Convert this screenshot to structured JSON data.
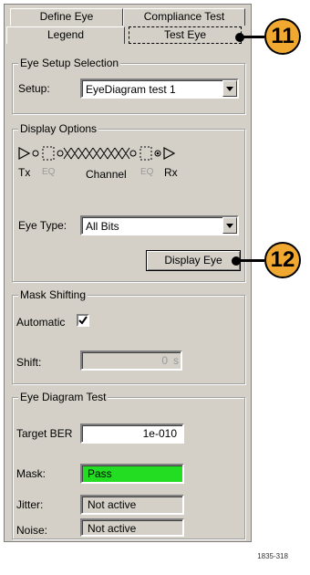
{
  "tabs": {
    "define_eye": "Define Eye",
    "compliance_test": "Compliance Test",
    "legend": "Legend",
    "test_eye": "Test Eye"
  },
  "eye_setup": {
    "title": "Eye Setup Selection",
    "setup_label": "Setup:",
    "setup_value": "EyeDiagram test 1"
  },
  "display_options": {
    "title": "Display Options",
    "tx_label": "Tx",
    "eq_left_label": "EQ",
    "channel_label": "Channel",
    "eq_right_label": "EQ",
    "rx_label": "Rx",
    "eye_type_label": "Eye Type:",
    "eye_type_value": "All Bits",
    "display_eye_button": "Display Eye"
  },
  "mask_shifting": {
    "title": "Mask Shifting",
    "automatic_label": "Automatic",
    "automatic_checked": true,
    "shift_label": "Shift:",
    "shift_value": "0",
    "shift_unit": "s"
  },
  "eye_diagram_test": {
    "title": "Eye Diagram Test",
    "target_ber_label": "Target BER",
    "target_ber_value": "1e-010",
    "mask_label": "Mask:",
    "mask_value": "Pass",
    "mask_color": "#22dd22",
    "jitter_label": "Jitter:",
    "jitter_value": "Not active",
    "noise_label": "Noise:",
    "noise_value": "Not active"
  },
  "callouts": {
    "callout_11": "11",
    "callout_12": "12",
    "callout_color": "#f0a830"
  },
  "figure_id": "1835-318"
}
